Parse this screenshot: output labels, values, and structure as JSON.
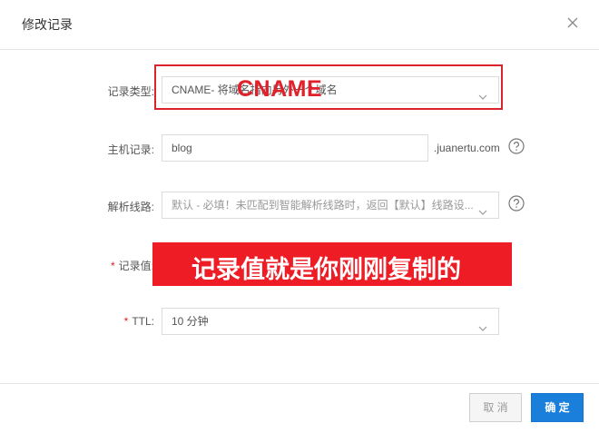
{
  "dialog": {
    "title": "修改记录",
    "close_icon": "close-icon"
  },
  "form": {
    "record_type": {
      "label": "记录类型:",
      "value": "CNAME- 将域名指向另外一个域名",
      "icon": "chevron-down-icon"
    },
    "host": {
      "label": "主机记录:",
      "value": "blog",
      "suffix": ".juanertu.com",
      "help_icon": "question-circle-icon"
    },
    "line": {
      "label": "解析线路:",
      "value": "默认 - 必填！未匹配到智能解析线路时，返回【默认】线路设...",
      "icon": "chevron-down-icon",
      "help_icon": "question-circle-icon"
    },
    "record_value": {
      "required_mark": "*",
      "label": "记录值:"
    },
    "ttl": {
      "required_mark": "*",
      "label": "TTL:",
      "value": "10 分钟",
      "icon": "chevron-down-icon"
    }
  },
  "annotations": {
    "type_label": "CNAME",
    "value_note": "记录值就是你刚刚复制的",
    "color": "#e0202a"
  },
  "footer": {
    "cancel_label": "取 消",
    "ok_label": "确 定",
    "accent": "#1a7fdb"
  }
}
